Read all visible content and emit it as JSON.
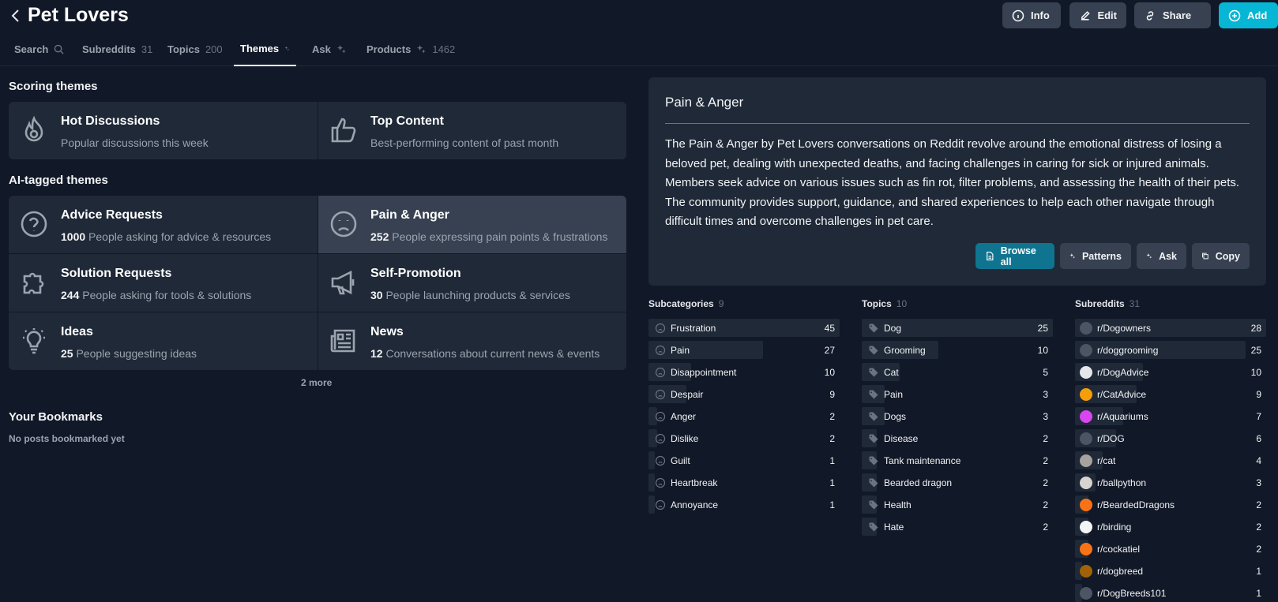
{
  "header": {
    "title": "Pet Lovers",
    "buttons": {
      "info": "Info",
      "edit": "Edit",
      "share": "Share",
      "add": "Add"
    }
  },
  "tabs": [
    {
      "label": "Search",
      "count": ""
    },
    {
      "label": "Subreddits",
      "count": "31"
    },
    {
      "label": "Topics",
      "count": "200"
    },
    {
      "label": "Themes",
      "count": ""
    },
    {
      "label": "Ask",
      "count": ""
    },
    {
      "label": "Products",
      "count": "1462"
    }
  ],
  "scoring": {
    "heading": "Scoring themes",
    "cards": [
      {
        "title": "Hot Discussions",
        "subtitle": "Popular discussions this week"
      },
      {
        "title": "Top Content",
        "subtitle": "Best-performing content of past month"
      }
    ]
  },
  "ai": {
    "heading": "AI-tagged themes",
    "cards": [
      {
        "title": "Advice Requests",
        "count": "1000",
        "subtitle": "People asking for advice & resources"
      },
      {
        "title": "Pain & Anger",
        "count": "252",
        "subtitle": "People expressing pain points & frustrations"
      },
      {
        "title": "Solution Requests",
        "count": "244",
        "subtitle": "People asking for tools & solutions"
      },
      {
        "title": "Self-Promotion",
        "count": "30",
        "subtitle": "People launching products & services"
      },
      {
        "title": "Ideas",
        "count": "25",
        "subtitle": "People suggesting ideas"
      },
      {
        "title": "News",
        "count": "12",
        "subtitle": "Conversations about current news & events"
      }
    ],
    "more": "2 more"
  },
  "bookmarks": {
    "heading": "Your Bookmarks",
    "empty": "No posts bookmarked yet"
  },
  "detail": {
    "title": "Pain & Anger",
    "description": "The Pain & Anger by Pet Lovers conversations on Reddit revolve around the emotional distress of losing a beloved pet, dealing with unexpected deaths, and facing challenges in caring for sick or injured animals. Members seek advice on various issues such as fin rot, filter problems, and assessing the health of their pets. The community provides support, guidance, and shared experiences to help each other navigate through difficult times and overcome challenges in pet care.",
    "buttons": {
      "browse": "Browse all",
      "patterns": "Patterns",
      "ask": "Ask",
      "copy": "Copy"
    }
  },
  "subcategories": {
    "label": "Subcategories",
    "count": "9",
    "max": 45,
    "items": [
      {
        "name": "Frustration",
        "value": 45
      },
      {
        "name": "Pain",
        "value": 27
      },
      {
        "name": "Disappointment",
        "value": 10
      },
      {
        "name": "Despair",
        "value": 9
      },
      {
        "name": "Anger",
        "value": 2
      },
      {
        "name": "Dislike",
        "value": 2
      },
      {
        "name": "Guilt",
        "value": 1
      },
      {
        "name": "Heartbreak",
        "value": 1
      },
      {
        "name": "Annoyance",
        "value": 1
      }
    ]
  },
  "topics": {
    "label": "Topics",
    "count": "10",
    "max": 25,
    "items": [
      {
        "name": "Dog",
        "value": 25
      },
      {
        "name": "Grooming",
        "value": 10
      },
      {
        "name": "Cat",
        "value": 5
      },
      {
        "name": "Pain",
        "value": 3
      },
      {
        "name": "Dogs",
        "value": 3
      },
      {
        "name": "Disease",
        "value": 2
      },
      {
        "name": "Tank maintenance",
        "value": 2
      },
      {
        "name": "Bearded dragon",
        "value": 2
      },
      {
        "name": "Health",
        "value": 2
      },
      {
        "name": "Hate",
        "value": 2
      }
    ]
  },
  "subreddits": {
    "label": "Subreddits",
    "count": "31",
    "max": 28,
    "items": [
      {
        "name": "r/Dogowners",
        "value": 28,
        "color": "#4b5563"
      },
      {
        "name": "r/doggrooming",
        "value": 25,
        "color": "#4b5563"
      },
      {
        "name": "r/DogAdvice",
        "value": 10,
        "color": "#e5e7eb"
      },
      {
        "name": "r/CatAdvice",
        "value": 9,
        "color": "#f59e0b"
      },
      {
        "name": "r/Aquariums",
        "value": 7,
        "color": "#d946ef"
      },
      {
        "name": "r/DOG",
        "value": 6,
        "color": "#4b5563"
      },
      {
        "name": "r/cat",
        "value": 4,
        "color": "#a8a29e"
      },
      {
        "name": "r/ballpython",
        "value": 3,
        "color": "#d6d3d1"
      },
      {
        "name": "r/BeardedDragons",
        "value": 2,
        "color": "#f97316"
      },
      {
        "name": "r/birding",
        "value": 2,
        "color": "#f3f4f6"
      },
      {
        "name": "r/cockatiel",
        "value": 2,
        "color": "#f97316"
      },
      {
        "name": "r/dogbreed",
        "value": 1,
        "color": "#a16207"
      },
      {
        "name": "r/DogBreeds101",
        "value": 1,
        "color": "#4b5563"
      }
    ]
  }
}
